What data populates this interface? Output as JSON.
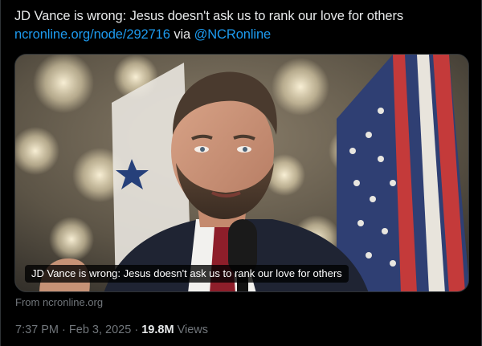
{
  "tweet": {
    "text_line1": "JD Vance is wrong: Jesus doesn't ask us to rank our love for others",
    "link_text": "ncronline.org/node/292716",
    "via_text": "via",
    "mention": "@NCRonline"
  },
  "card": {
    "image_caption": "JD Vance is wrong: Jesus doesn't ask us to rank our love for others",
    "source": "From ncronline.org"
  },
  "meta": {
    "time": "7:37 PM",
    "separator1": "·",
    "date": "Feb 3, 2025",
    "separator2": "·",
    "views_count": "19.8M",
    "views_label": "Views"
  },
  "colors": {
    "background": "#000000",
    "text": "#e7e9ea",
    "link": "#1d9bf0",
    "muted": "#71767b",
    "border": "#2f3336"
  }
}
